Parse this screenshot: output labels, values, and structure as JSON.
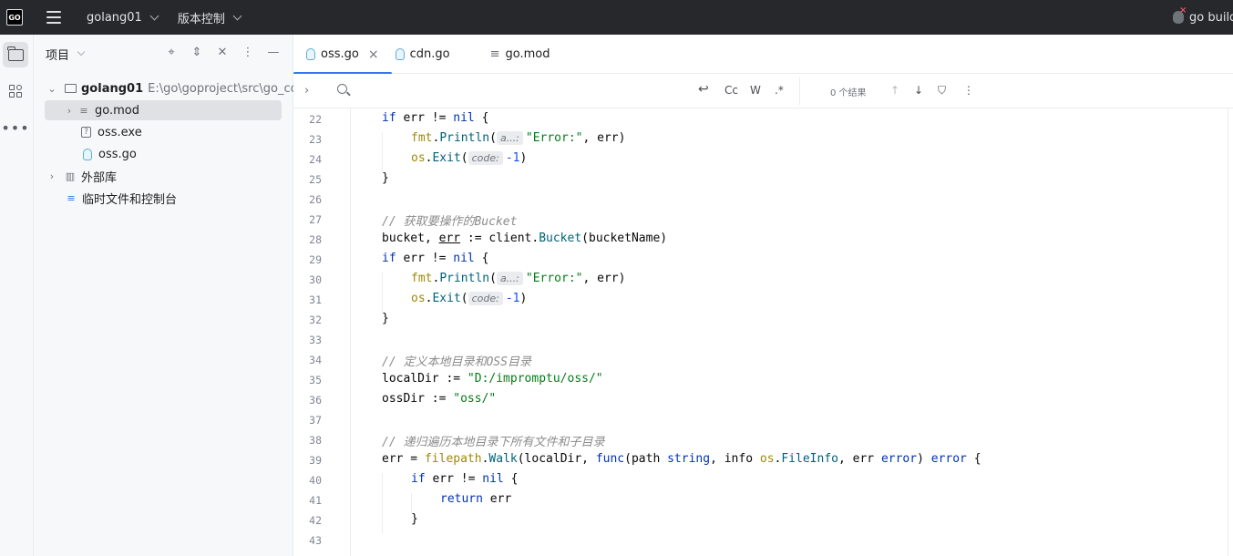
{
  "titlebar": {
    "project_name": "golang01",
    "vcs_label": "版本控制",
    "run_config": "go build",
    "logo_text": "GO"
  },
  "project_panel": {
    "title": "项目",
    "tree": [
      {
        "label": "golang01",
        "extra": "E:\\go\\goproject\\src\\go_code"
      },
      {
        "label": "go.mod"
      },
      {
        "label": "oss.exe"
      },
      {
        "label": "oss.go"
      },
      {
        "label": "外部库"
      },
      {
        "label": "临时文件和控制台"
      }
    ]
  },
  "tabs": [
    {
      "label": "oss.go",
      "active": true
    },
    {
      "label": "cdn.go",
      "active": false
    },
    {
      "label": "go.mod",
      "active": false
    }
  ],
  "search": {
    "case_label": "Cc",
    "word_label": "W",
    "regex_label": ".*",
    "results": "0 个结果"
  },
  "code": {
    "hint_a": "a...:",
    "hint_code": "code:",
    "lines": [
      {
        "n": "22",
        "t": "if err != nil {"
      },
      {
        "n": "23",
        "t": "fmt.Println(\"Error:\", err)"
      },
      {
        "n": "24",
        "t": "os.Exit(-1)"
      },
      {
        "n": "25",
        "t": "}"
      },
      {
        "n": "26",
        "t": ""
      },
      {
        "n": "27",
        "t": "// 获取要操作的Bucket"
      },
      {
        "n": "28",
        "t": "bucket, err := client.Bucket(bucketName)"
      },
      {
        "n": "29",
        "t": "if err != nil {"
      },
      {
        "n": "30",
        "t": "fmt.Println(\"Error:\", err)"
      },
      {
        "n": "31",
        "t": "os.Exit(-1)"
      },
      {
        "n": "32",
        "t": "}"
      },
      {
        "n": "33",
        "t": ""
      },
      {
        "n": "34",
        "t": "// 定义本地目录和OSS目录"
      },
      {
        "n": "35",
        "t": "localDir := \"D:/impromptu/oss/\""
      },
      {
        "n": "36",
        "t": "ossDir := \"oss/\""
      },
      {
        "n": "37",
        "t": ""
      },
      {
        "n": "38",
        "t": "// 递归遍历本地目录下所有文件和子目录"
      },
      {
        "n": "39",
        "t": "err = filepath.Walk(localDir, func(path string, info os.FileInfo, err error) error {"
      },
      {
        "n": "40",
        "t": "if err != nil {"
      },
      {
        "n": "41",
        "t": "return err"
      },
      {
        "n": "42",
        "t": "}"
      },
      {
        "n": "43",
        "t": ""
      }
    ]
  }
}
